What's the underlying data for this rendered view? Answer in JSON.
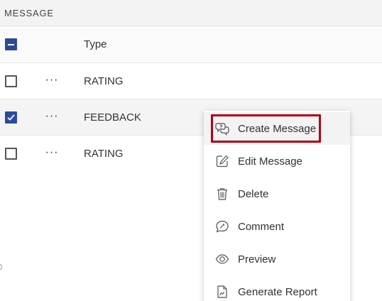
{
  "section": {
    "title": "MESSAGE"
  },
  "table": {
    "column_header": "Type",
    "rows": [
      {
        "type": "RATING",
        "checked": false
      },
      {
        "type": "FEEDBACK",
        "checked": true
      },
      {
        "type": "RATING",
        "checked": false
      }
    ],
    "row_menu_glyph": "···"
  },
  "context_menu": {
    "items": [
      {
        "label": "Create Message",
        "icon": "create-message-icon"
      },
      {
        "label": "Edit Message",
        "icon": "edit-icon"
      },
      {
        "label": "Delete",
        "icon": "trash-icon"
      },
      {
        "label": "Comment",
        "icon": "comment-icon"
      },
      {
        "label": "Preview",
        "icon": "eye-icon"
      },
      {
        "label": "Generate Report",
        "icon": "report-icon"
      }
    ]
  },
  "colors": {
    "accent": "#2b4a9b",
    "highlight": "#b00012"
  }
}
